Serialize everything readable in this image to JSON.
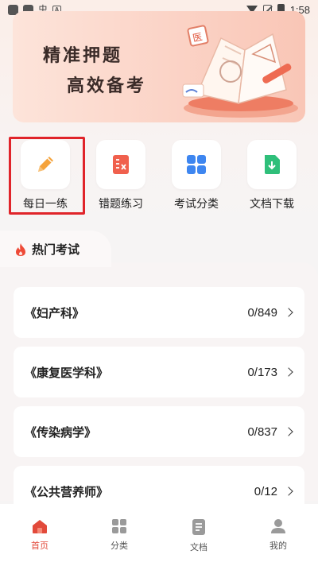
{
  "status_bar": {
    "time": "1:58"
  },
  "banner": {
    "line1": "精准押题",
    "line2": "高效备考"
  },
  "quick_actions": [
    {
      "label": "每日一练",
      "icon": "pencil-icon",
      "color": "#f5a33b",
      "highlighted": true
    },
    {
      "label": "错题练习",
      "icon": "error-notebook-icon",
      "color": "#f0604d"
    },
    {
      "label": "考试分类",
      "icon": "grid-icon",
      "color": "#3e86f0"
    },
    {
      "label": "文档下载",
      "icon": "document-download-icon",
      "color": "#2fbf7a"
    }
  ],
  "hot_section": {
    "title": "热门考试",
    "icon": "flame-icon"
  },
  "exams": [
    {
      "name": "《妇产科》",
      "progress": "0/849"
    },
    {
      "name": "《康复医学科》",
      "progress": "0/173"
    },
    {
      "name": "《传染病学》",
      "progress": "0/837"
    },
    {
      "name": "《公共营养师》",
      "progress": "0/12"
    }
  ],
  "tab_bar": [
    {
      "label": "首页",
      "icon": "home-icon",
      "active": true
    },
    {
      "label": "分类",
      "icon": "category-icon",
      "active": false
    },
    {
      "label": "文档",
      "icon": "document-icon",
      "active": false
    },
    {
      "label": "我的",
      "icon": "profile-icon",
      "active": false
    }
  ],
  "colors": {
    "accent": "#e24a3b",
    "highlight_border": "#e0242a"
  }
}
